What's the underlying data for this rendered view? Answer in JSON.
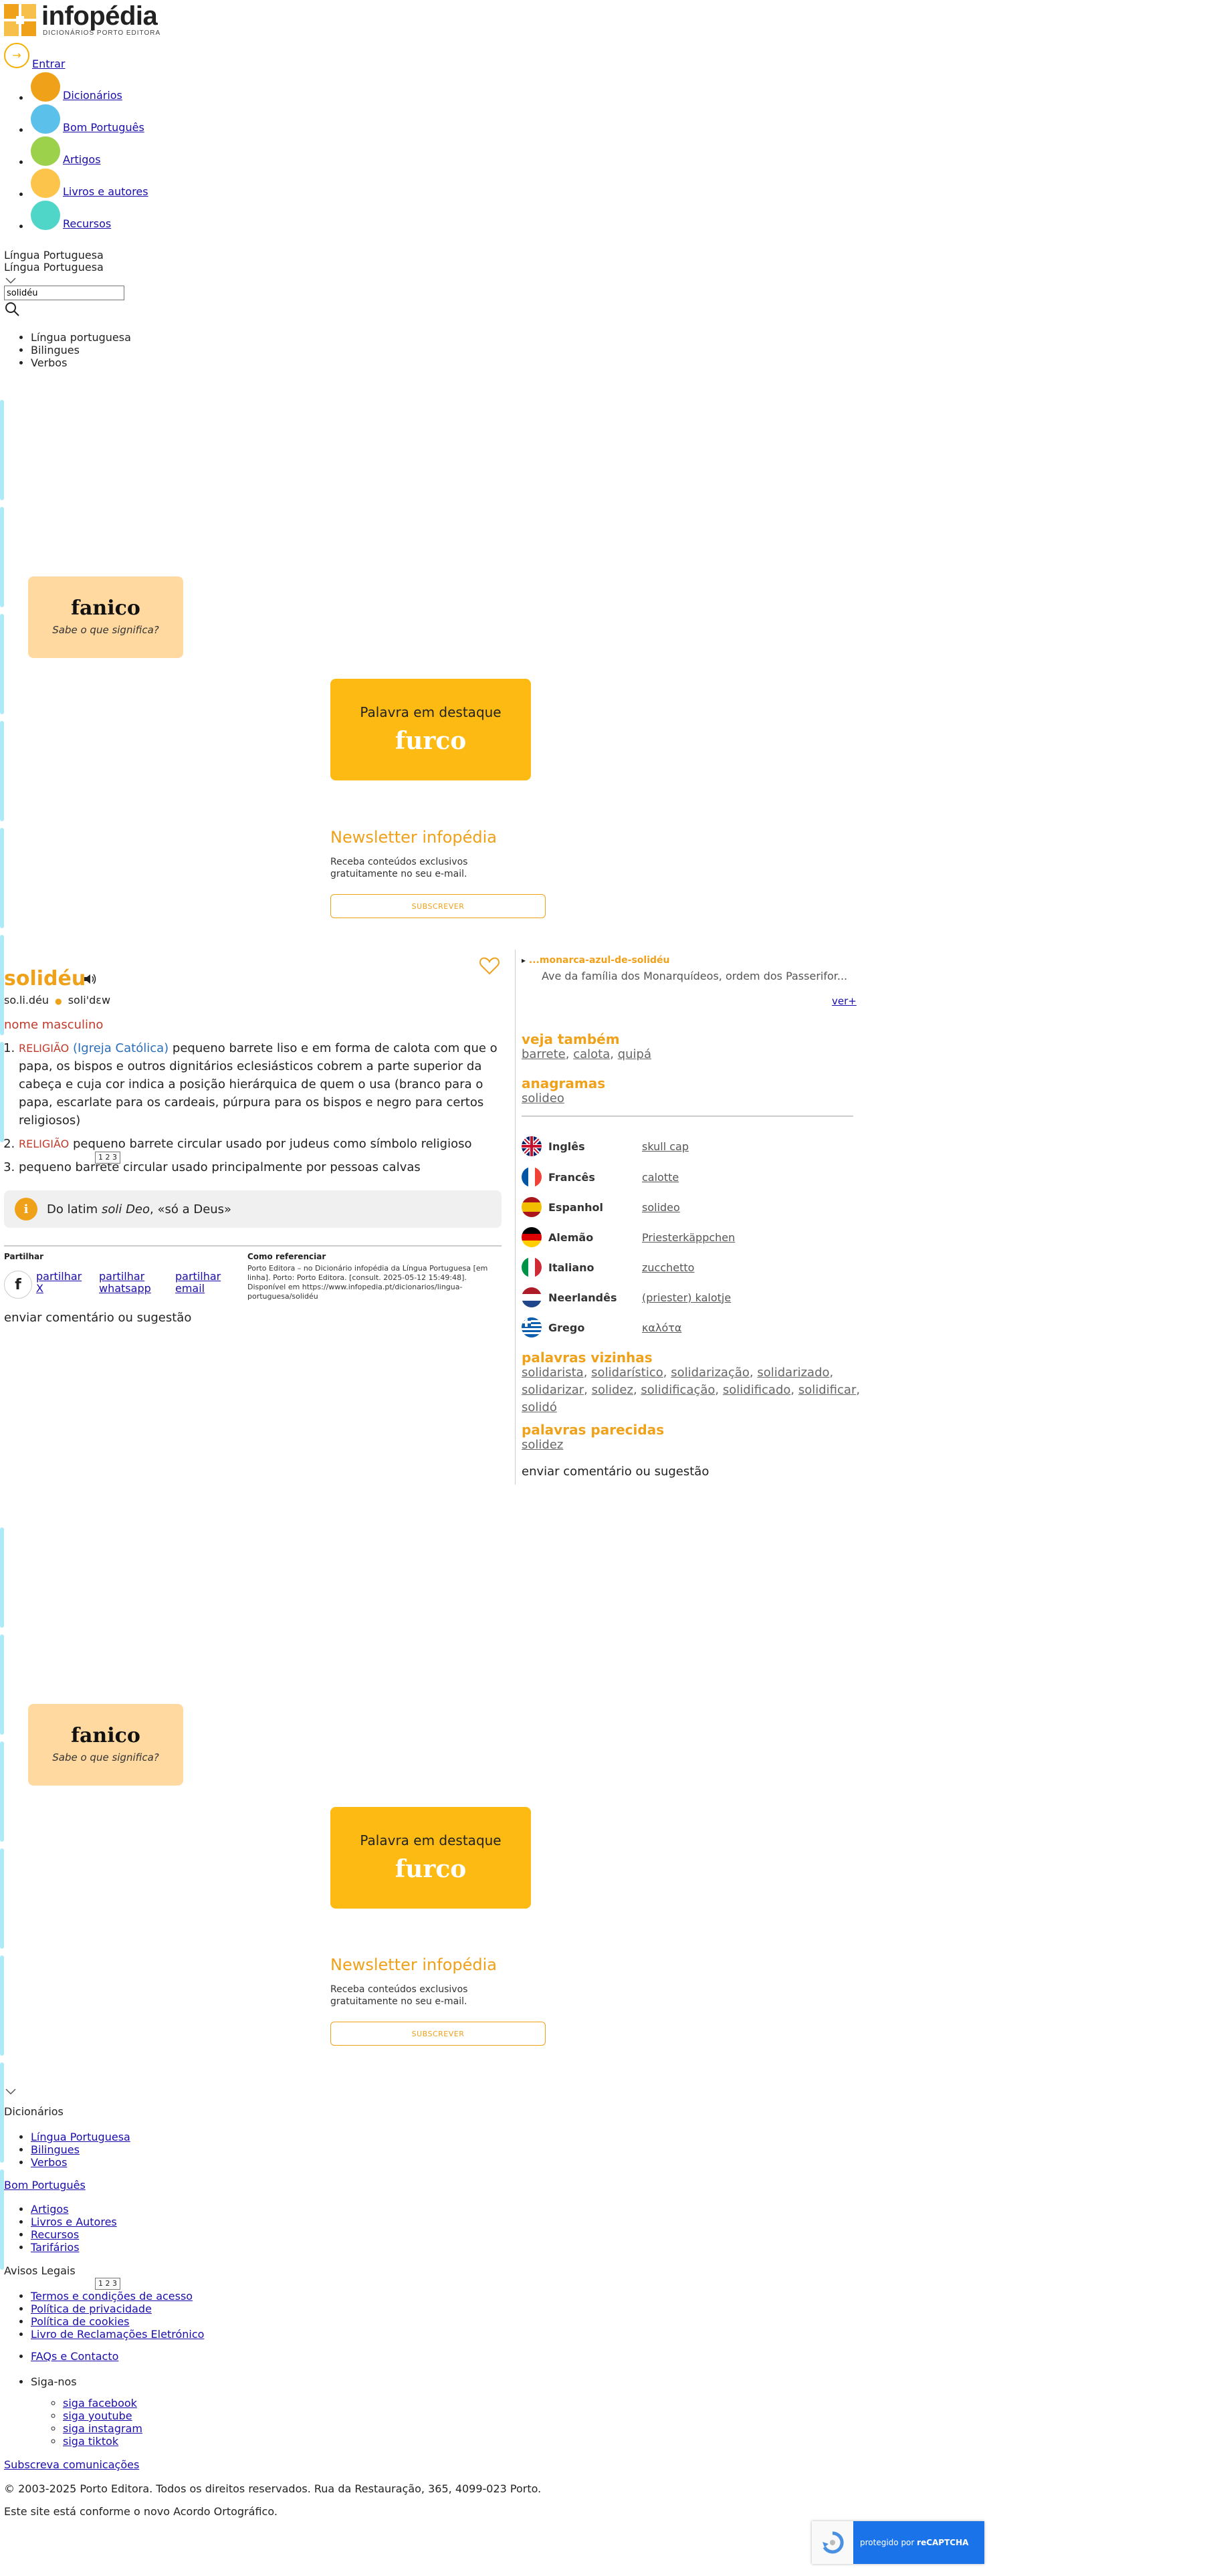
{
  "header": {
    "logo_text": "infopédia",
    "logo_sub": "DICIONÁRIOS PORTO EDITORA",
    "login_label": "Entrar"
  },
  "nav": {
    "items": [
      {
        "label": "Dicionários",
        "color": "#f0a11a"
      },
      {
        "label": "Bom Português",
        "color": "#5bc0ea"
      },
      {
        "label": "Artigos",
        "color": "#9bd14b"
      },
      {
        "label": "Livros e autores",
        "color": "#fcc44a"
      },
      {
        "label": "Recursos",
        "color": "#4fd6c8"
      }
    ]
  },
  "search": {
    "lang_selected": "Língua Portuguesa",
    "lang_display": "Língua Portuguesa",
    "query": "solidéu",
    "dictionaries": [
      "Língua portuguesa",
      "Bilingues",
      "Verbos"
    ]
  },
  "promo": {
    "fanico_word": "fanico",
    "fanico_question": "Sabe o que significa?",
    "featured_label": "Palavra em destaque",
    "featured_word": "furco",
    "newsletter_title": "Newsletter infopédia",
    "newsletter_text": "Receba conteúdos exclusivos gratuitamente no seu e-mail.",
    "newsletter_button": "SUBSCREVER"
  },
  "entry": {
    "word": "solidéu",
    "syllables": "so.li.déu",
    "pronunciation": "soli'dɛw",
    "grammar": "nome masculino",
    "senses": [
      {
        "domain": "RELIGIÃO",
        "subdomain": "(Igreja Católica)",
        "text": "pequeno barrete liso e em forma de calota com que o papa, os bispos e outros dignitários eclesiásticos cobrem a parte superior da cabeça e cuja cor indica a posição hierárquica de quem o usa (branco para o papa, escarlate para os cardeais, púrpura para os bispos e negro para certos religiosos)"
      },
      {
        "domain": "RELIGIÃO",
        "subdomain": "",
        "text": "pequeno barrete circular usado por judeus como símbolo religioso"
      },
      {
        "domain": "",
        "subdomain": "",
        "text": "pequeno barrete circular usado principalmente por pessoas calvas"
      }
    ],
    "tiny_box": "1 2 3",
    "etymology_prefix": "Do latim ",
    "etymology_italic": "soli Deo",
    "etymology_suffix": ", «só a Deus»",
    "share_label": "Partilhar",
    "share_links": [
      "partilhar X",
      "partilhar whatsapp",
      "partilhar email"
    ],
    "cite_label": "Como referenciar",
    "cite_text": "Porto Editora – no Dicionário infopédia da Língua Portuguesa [em linha]. Porto: Porto Editora. [consult. 2025-05-12 15:49:48]. Disponível em https://www.infopedia.pt/dicionarios/lingua-portuguesa/solidéu",
    "feedback": "enviar comentário ou sugestão"
  },
  "right": {
    "related_word": "...monarca-azul-de-solidéu",
    "related_desc": "Ave da família dos Monarquídeos, ordem dos Passerifor...",
    "more": "ver+",
    "see_also_title": "veja também",
    "see_also": [
      "barrete",
      "calota",
      "quipá"
    ],
    "anagrams_title": "anagramas",
    "anagrams": [
      "solideo"
    ],
    "translations": [
      {
        "lang": "Inglês",
        "word": "skull cap",
        "flag": "uk"
      },
      {
        "lang": "Francês",
        "word": "calotte",
        "flag": "fr"
      },
      {
        "lang": "Espanhol",
        "word": "solideo",
        "flag": "es"
      },
      {
        "lang": "Alemão",
        "word": "Priesterkäppchen",
        "flag": "de"
      },
      {
        "lang": "Italiano",
        "word": "zucchetto",
        "flag": "it"
      },
      {
        "lang": "Neerlandês",
        "word": "(priester) kalotje",
        "flag": "nl"
      },
      {
        "lang": "Grego",
        "word": "καλότα",
        "flag": "gr"
      }
    ],
    "neighbors_title": "palavras vizinhas",
    "neighbors": [
      "solidarista",
      "solidarístico",
      "solidarização",
      "solidarizado",
      "solidarizar",
      "solidez",
      "solidificação",
      "solidificado",
      "solidificar",
      "solidó"
    ],
    "similar_title": "palavras parecidas",
    "similar": [
      "solidez"
    ],
    "feedback": "enviar comentário ou sugestão"
  },
  "footer": {
    "dicts_label": "Dicionários",
    "dicts": [
      "Língua Portuguesa",
      "Bilingues",
      "Verbos"
    ],
    "bom_portugues": "Bom Português",
    "more_links": [
      "Artigos",
      "Livros e Autores",
      "Recursos",
      "Tarifários"
    ],
    "legal_label": "Avisos Legais",
    "legal_links": [
      "Termos e condições de acesso",
      "Política de privacidade",
      "Política de cookies",
      "Livro de Reclamações Eletrónico"
    ],
    "faq": "FAQs e Contacto",
    "follow_label": "Siga-nos",
    "social": [
      "siga facebook",
      "siga youtube",
      "siga instagram",
      "siga tiktok"
    ],
    "subscribe": "Subscreva comunicações",
    "copyright": "© 2003-2025 Porto Editora. Todos os direitos reservados. Rua da Restauração, 365, 4099-023 Porto.",
    "ortografia": "Este site está conforme o novo Acordo Ortográfico.",
    "recaptcha_prefix": "protegido por ",
    "recaptcha_brand": "reCAPTCHA",
    "tiny_box": "1 2 3"
  }
}
